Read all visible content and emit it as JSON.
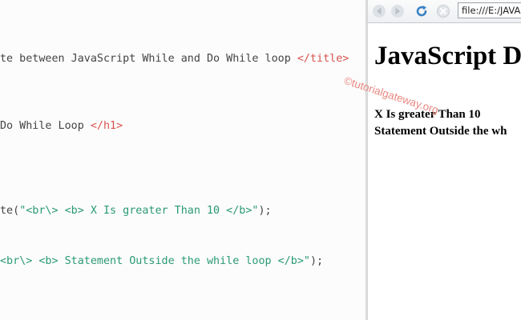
{
  "editor": {
    "lines": [
      {
        "pre": "te between JavaScript While and Do While loop ",
        "tag": "</title>"
      },
      {
        "pre": "Do While Loop ",
        "tag": "</h1>"
      },
      {
        "pre": "te(",
        "str": "\"<br\\> <b> X Is greater Than 10 </b>\"",
        "post": ");"
      },
      {
        "str": "<br\\> <b> Statement Outside the while loop </b>\"",
        "post": ");"
      }
    ]
  },
  "browser": {
    "address": "file:///E:/JAVA",
    "buttons": {
      "back_icon": "back-arrow-icon",
      "forward_icon": "forward-arrow-icon",
      "reload_icon": "reload-icon",
      "stop_icon": "stop-icon"
    },
    "page": {
      "heading": "JavaScript D",
      "output": [
        "X Is greater Than 10",
        "Statement Outside the wh"
      ]
    }
  },
  "watermark": "©tutorialgateway.org",
  "colors": {
    "string": "#2a9a73",
    "tag": "#d9534f",
    "text": "#444444",
    "watermark": "#e4726a"
  }
}
